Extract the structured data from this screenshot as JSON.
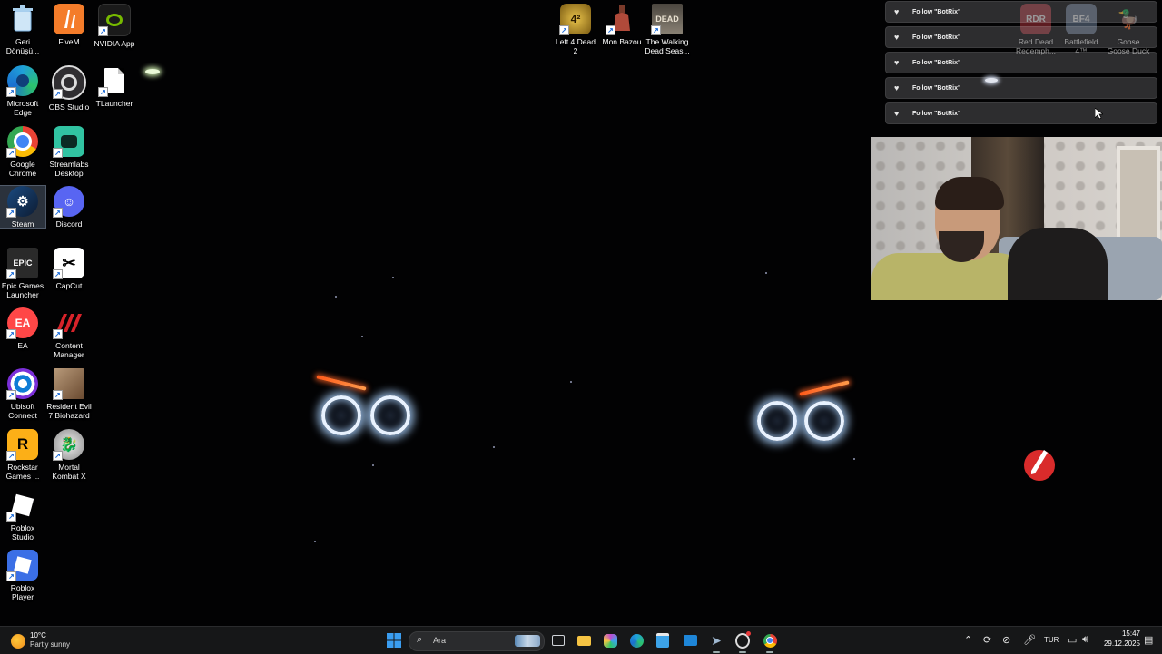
{
  "desktop": {
    "icons": [
      {
        "name": "recycle-bin",
        "label": "Geri Dönüşü...",
        "icon": "recycle-bin-icon",
        "color": "#7fb6e6"
      },
      {
        "name": "fivem",
        "label": "FiveM",
        "icon": "fivem-icon",
        "color": "#f47c2a"
      },
      {
        "name": "nvidia-app",
        "label": "NVIDIA App",
        "icon": "nvidia-icon",
        "color": "#76b900"
      },
      {
        "name": "microsoft-edge",
        "label": "Microsoft Edge",
        "icon": "edge-icon",
        "color": "#1fa0d8"
      },
      {
        "name": "obs-studio",
        "label": "OBS Studio",
        "icon": "obs-icon",
        "color": "#302e31"
      },
      {
        "name": "tlauncher",
        "label": "TLauncher",
        "icon": "file-icon",
        "color": "#ffffff"
      },
      {
        "name": "google-chrome",
        "label": "Google Chrome",
        "icon": "chrome-icon",
        "color": "#e94235"
      },
      {
        "name": "streamlabs-desktop",
        "label": "Streamlabs Desktop",
        "icon": "streamlabs-icon",
        "color": "#31c3a2"
      },
      {
        "name": "steam",
        "label": "Steam",
        "icon": "steam-icon",
        "color": "#1b2838"
      },
      {
        "name": "discord",
        "label": "Discord",
        "icon": "discord-icon",
        "color": "#5865f2"
      },
      {
        "name": "epic-games-launcher",
        "label": "Epic Games Launcher",
        "icon": "epic-icon",
        "color": "#2a2a2a"
      },
      {
        "name": "capcut",
        "label": "CapCut",
        "icon": "capcut-icon",
        "color": "#ffffff"
      },
      {
        "name": "ea",
        "label": "EA",
        "icon": "ea-icon",
        "color": "#ff4747"
      },
      {
        "name": "content-manager",
        "label": "Content Manager",
        "icon": "content-manager-icon",
        "color": "#d8232a"
      },
      {
        "name": "ubisoft-connect",
        "label": "Ubisoft Connect",
        "icon": "ubisoft-icon",
        "color": "#0f7dd6"
      },
      {
        "name": "resident-evil-7",
        "label": "Resident Evil 7 Biohazard",
        "icon": "re7-icon",
        "color": "#8a6a4a"
      },
      {
        "name": "rockstar-games",
        "label": "Rockstar Games ...",
        "icon": "rockstar-icon",
        "color": "#fcaf17"
      },
      {
        "name": "mortal-kombat-x",
        "label": "Mortal Kombat X",
        "icon": "mkx-icon",
        "color": "#cccccc"
      },
      {
        "name": "roblox-studio",
        "label": "Roblox Studio",
        "icon": "roblox-studio-icon",
        "color": "#ffffff"
      },
      {
        "name": "roblox-player",
        "label": "Roblox Player",
        "icon": "roblox-icon",
        "color": "#3b6fe6"
      },
      {
        "name": "left-4-dead-2",
        "label": "Left 4 Dead 2",
        "icon": "l4d2-icon",
        "color": "#c8a02a"
      },
      {
        "name": "mon-bazou",
        "label": "Mon Bazou",
        "icon": "mon-bazou-icon",
        "color": "#b04a3a"
      },
      {
        "name": "walking-dead",
        "label": "The Walking Dead Seas...",
        "icon": "walking-dead-icon",
        "color": "#8a8275"
      },
      {
        "name": "red-dead-redemption",
        "label": "Red Dead Redemph...",
        "icon": "rdr-icon",
        "color": "#a8323a"
      },
      {
        "name": "battlefield-4",
        "label": "Battlefield 4™",
        "icon": "bf4-icon",
        "color": "#6b7d96"
      },
      {
        "name": "goose-goose-duck",
        "label": "Goose Goose Duck",
        "icon": "goose-icon",
        "color": "#d8d8d8"
      }
    ]
  },
  "overlay": {
    "follow_alerts": [
      {
        "text": "Follow \"BotRix\""
      },
      {
        "text": "Follow \"BotRix\""
      },
      {
        "text": "Follow \"BotRix\""
      },
      {
        "text": "Follow \"BotRix\""
      },
      {
        "text": "Follow \"BotRix\""
      }
    ]
  },
  "taskbar": {
    "weather": {
      "temp": "10°C",
      "condition": "Partly sunny",
      "icon": "sun-cloud-icon"
    },
    "search_placeholder": "Ara",
    "pinned": [
      {
        "name": "start",
        "icon": "windows-icon",
        "color": "#3a9df0"
      },
      {
        "name": "task-view",
        "icon": "task-view-icon",
        "color": "#cfd3d8"
      },
      {
        "name": "file-explorer",
        "icon": "folder-icon",
        "color": "#f6c443"
      },
      {
        "name": "microsoft-365",
        "icon": "office-icon",
        "color": "#c04ad0"
      },
      {
        "name": "edge",
        "icon": "edge-icon",
        "color": "#1fa0d8"
      },
      {
        "name": "microsoft-store",
        "icon": "store-icon",
        "color": "#3ca3e8"
      },
      {
        "name": "outlook",
        "icon": "mail-icon",
        "color": "#1e86d8"
      },
      {
        "name": "steam",
        "icon": "steam-icon",
        "color": "#9fb8d0"
      },
      {
        "name": "obs",
        "icon": "obs-icon",
        "color": "#dcdcdc"
      },
      {
        "name": "chrome",
        "icon": "chrome-icon",
        "color": "#e94235"
      }
    ],
    "tray": {
      "language": "TUR",
      "time": "15:47",
      "date": "29.12.2025"
    }
  }
}
